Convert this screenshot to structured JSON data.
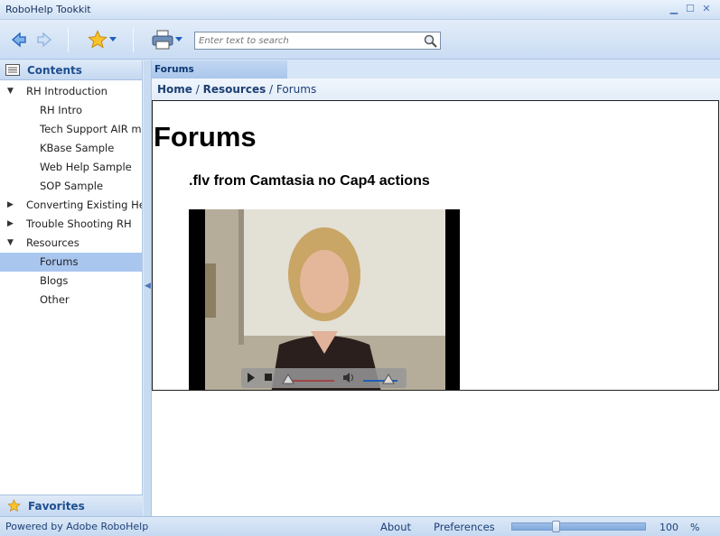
{
  "window": {
    "title": "RoboHelp Tookkit"
  },
  "toolbar": {
    "search_placeholder": "Enter text to search"
  },
  "sidebar": {
    "contents_label": "Contents",
    "favorites_label": "Favorites",
    "items": [
      {
        "label": "RH Introduction",
        "level": 0,
        "arrow": "▼"
      },
      {
        "label": "RH Intro",
        "level": 1
      },
      {
        "label": "Tech Support AIR m",
        "level": 1
      },
      {
        "label": "KBase Sample",
        "level": 1
      },
      {
        "label": "Web Help Sample",
        "level": 1
      },
      {
        "label": "SOP Sample",
        "level": 1
      },
      {
        "label": "Converting Existing He",
        "level": 0,
        "arrow": "▶"
      },
      {
        "label": "Trouble Shooting RH",
        "level": 0,
        "arrow": "▶"
      },
      {
        "label": "Resources",
        "level": 0,
        "arrow": "▼"
      },
      {
        "label": "Forums",
        "level": 1,
        "selected": true
      },
      {
        "label": "Blogs",
        "level": 1
      },
      {
        "label": "Other",
        "level": 1
      }
    ]
  },
  "tab": {
    "label": "Forums"
  },
  "breadcrumb": {
    "home": "Home",
    "sep1": " / ",
    "resources": "Resources",
    "sep2": " / ",
    "current": "Forums"
  },
  "main": {
    "heading": "Forums",
    "subheading": ".flv from Camtasia no Cap4 actions"
  },
  "status": {
    "powered_by": "Powered by Adobe RoboHelp",
    "about": "About",
    "preferences": "Preferences",
    "zoom_value": "100",
    "zoom_unit": "%"
  },
  "colors": {
    "accent": "#1f4f8f",
    "selection": "#a9c6ef",
    "chrome": "#c9dcf3"
  }
}
